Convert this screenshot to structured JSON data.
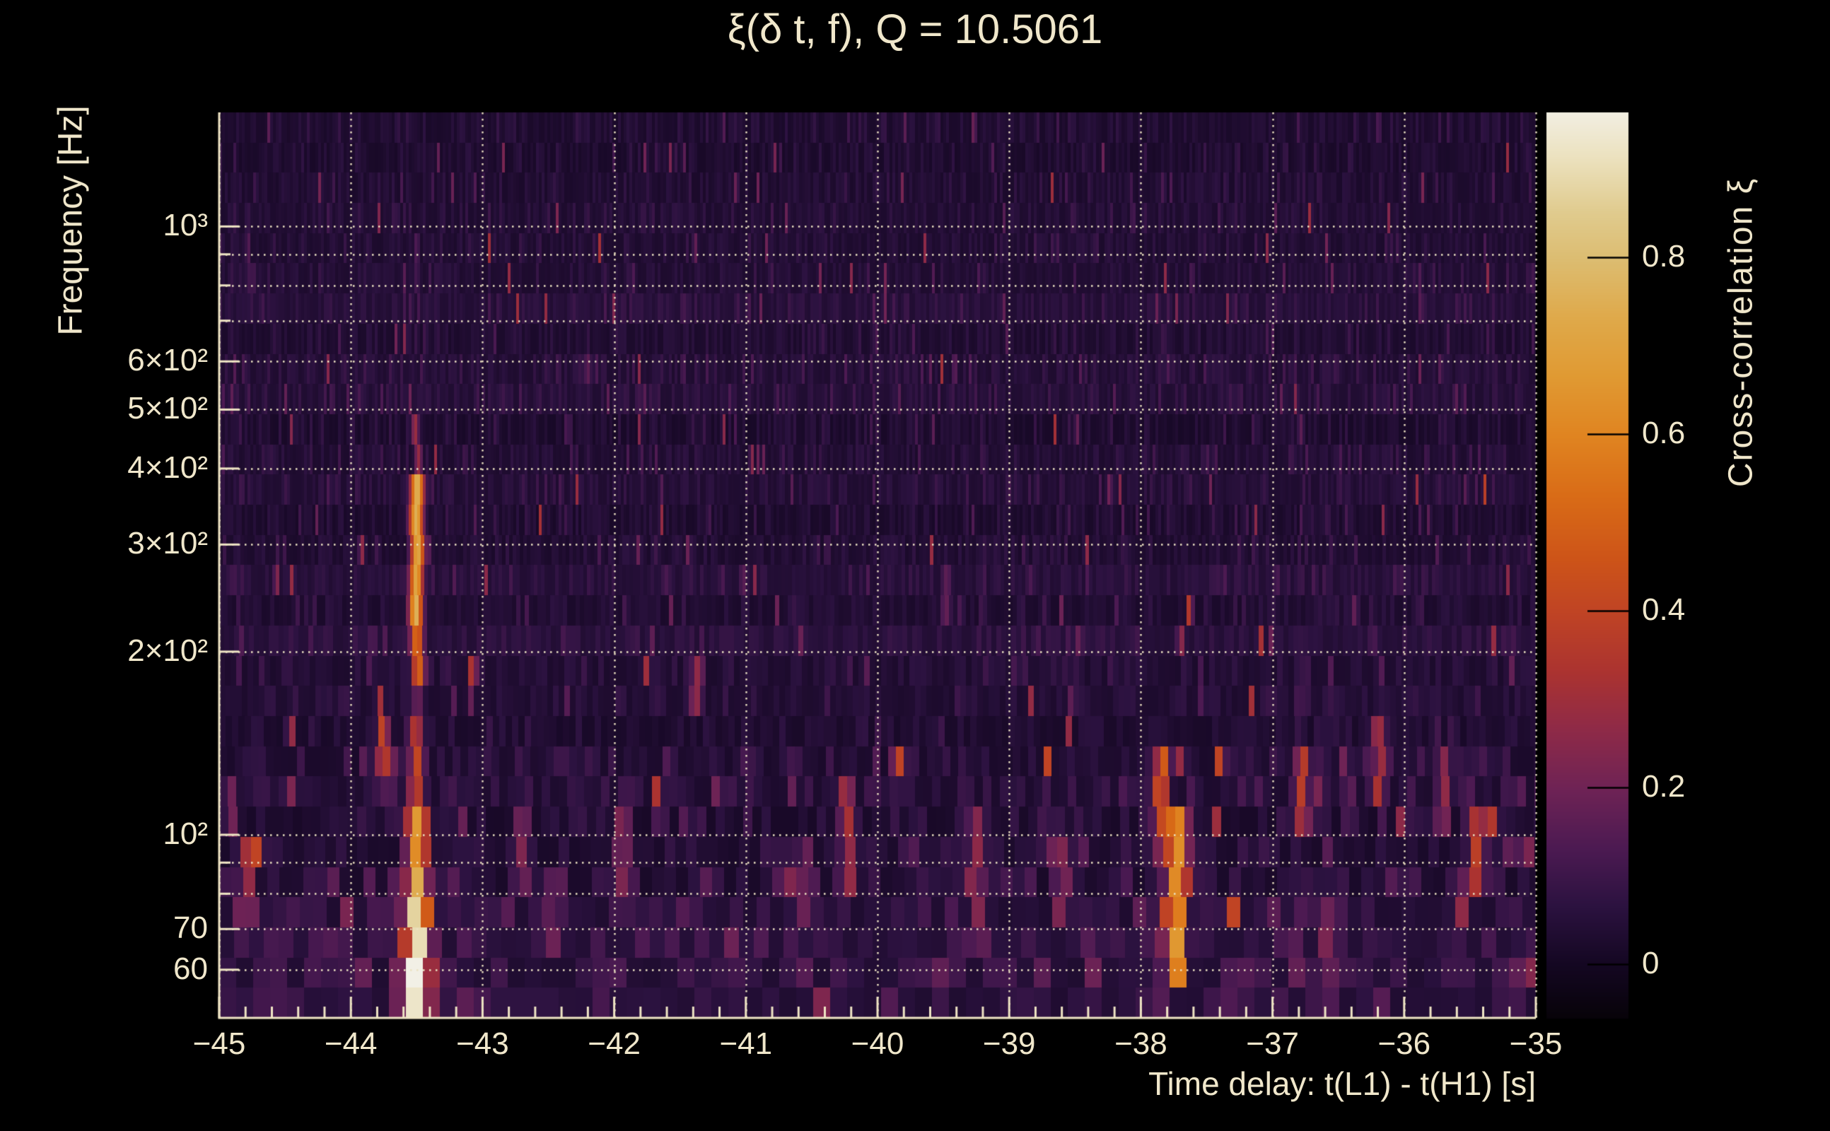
{
  "page": {
    "background": "#000000",
    "text_color": "#f0e7cb",
    "accent_grid_color": "#ece2c2"
  },
  "chart_data": {
    "type": "heatmap",
    "title": "ξ(δ t, f), Q = 10.5061",
    "q_value": "10.5061",
    "xlabel": "Time delay: t(L1) - t(H1) [s]",
    "ylabel": "Frequency [Hz]",
    "zlabel": "Cross-correlation ξ",
    "x_axis": {
      "min": -45,
      "max": -35,
      "minor_step": 0.2,
      "ticks": [
        {
          "t": -45,
          "label": "−45"
        },
        {
          "t": -44,
          "label": "−44"
        },
        {
          "t": -43,
          "label": "−43"
        },
        {
          "t": -42,
          "label": "−42"
        },
        {
          "t": -41,
          "label": "−41"
        },
        {
          "t": -40,
          "label": "−40"
        },
        {
          "t": -39,
          "label": "−39"
        },
        {
          "t": -38,
          "label": "−38"
        },
        {
          "t": -37,
          "label": "−37"
        },
        {
          "t": -36,
          "label": "−36"
        },
        {
          "t": -35,
          "label": "−35"
        }
      ]
    },
    "y_axis": {
      "scale": "log",
      "min_hz": 50,
      "max_hz": 1540,
      "gridline_freqs": [
        60,
        70,
        80,
        90,
        100,
        200,
        300,
        400,
        500,
        600,
        700,
        800,
        900,
        1000
      ],
      "ticks": [
        {
          "f": 1000,
          "label": "10³"
        },
        {
          "f": 600,
          "label": "6×10²"
        },
        {
          "f": 500,
          "label": "5×10²"
        },
        {
          "f": 400,
          "label": "4×10²"
        },
        {
          "f": 300,
          "label": "3×10²"
        },
        {
          "f": 200,
          "label": "2×10²"
        },
        {
          "f": 100,
          "label": "10²"
        },
        {
          "f": 70,
          "label": "70"
        },
        {
          "f": 60,
          "label": "60"
        }
      ]
    },
    "z_axis": {
      "min": -0.061,
      "max": 0.964,
      "ticks": [
        {
          "v": 0.8,
          "label": "0.8"
        },
        {
          "v": 0.6,
          "label": "0.6"
        },
        {
          "v": 0.4,
          "label": "0.4"
        },
        {
          "v": 0.2,
          "label": "0.2"
        },
        {
          "v": 0.0,
          "label": "0"
        }
      ]
    },
    "colormap": [
      [
        -0.061,
        "#070309"
      ],
      [
        0.0,
        "#140722"
      ],
      [
        0.067,
        "#2c1240"
      ],
      [
        0.131,
        "#4c1a52"
      ],
      [
        0.2,
        "#6f2355"
      ],
      [
        0.267,
        "#8f2a47"
      ],
      [
        0.331,
        "#ab3330"
      ],
      [
        0.4,
        "#c04424"
      ],
      [
        0.459,
        "#cd5418"
      ],
      [
        0.531,
        "#d96c17"
      ],
      [
        0.601,
        "#e08521"
      ],
      [
        0.667,
        "#e09a33"
      ],
      [
        0.731,
        "#dfa94a"
      ],
      [
        0.8,
        "#dcbd72"
      ],
      [
        0.851,
        "#e0cb8e"
      ],
      [
        0.915,
        "#ece2c0"
      ],
      [
        0.971,
        "#f2f0e6"
      ]
    ],
    "grid": {
      "style": "dotted",
      "color": "#ece2c2",
      "dash": [
        2.5,
        6.5
      ]
    },
    "noise": {
      "seed": 1337,
      "rows": 30,
      "band_boost_hz": [
        55,
        140
      ]
    },
    "features": [
      {
        "t": -43.5,
        "f_lo": 360,
        "f_hi": 490,
        "xi": 0.3,
        "sigma": 4
      },
      {
        "t": -43.5,
        "f_lo": 230,
        "f_hi": 360,
        "xi": 0.76,
        "sigma": 7
      },
      {
        "t": -43.5,
        "f_lo": 185,
        "f_hi": 230,
        "xi": 0.55,
        "sigma": 7
      },
      {
        "t": -43.5,
        "f_lo": 145,
        "f_hi": 185,
        "xi": 0.22,
        "sigma": 5
      },
      {
        "t": -43.5,
        "f_lo": 100,
        "f_hi": 145,
        "xi": 0.38,
        "sigma": 8
      },
      {
        "t": -43.5,
        "f_lo": 76,
        "f_hi": 100,
        "xi": 0.68,
        "sigma": 11
      },
      {
        "t": -43.5,
        "f_lo": 62,
        "f_hi": 76,
        "xi": 0.85,
        "sigma": 13
      },
      {
        "t": -43.5,
        "f_lo": 50,
        "f_hi": 62,
        "xi": 0.96,
        "sigma": 14
      },
      {
        "t": -44.79,
        "f_lo": 74,
        "f_hi": 96,
        "xi": 0.32,
        "sigma": 9
      },
      {
        "t": -44.9,
        "f_lo": 100,
        "f_hi": 122,
        "xi": 0.2,
        "sigma": 8
      },
      {
        "t": -44.6,
        "f_lo": 50,
        "f_hi": 60,
        "xi": 0.13,
        "sigma": 18
      },
      {
        "t": -43.75,
        "f_lo": 128,
        "f_hi": 150,
        "xi": 0.45,
        "sigma": 6
      },
      {
        "t": -42.7,
        "f_lo": 84,
        "f_hi": 100,
        "xi": 0.22,
        "sigma": 9
      },
      {
        "t": -42.45,
        "f_lo": 70,
        "f_hi": 88,
        "xi": 0.2,
        "sigma": 10
      },
      {
        "t": -42.1,
        "f_lo": 50,
        "f_hi": 58,
        "xi": 0.12,
        "sigma": 16
      },
      {
        "t": -41.93,
        "f_lo": 84,
        "f_hi": 106,
        "xi": 0.24,
        "sigma": 9
      },
      {
        "t": -41.37,
        "f_lo": 158,
        "f_hi": 186,
        "xi": 0.26,
        "sigma": 7
      },
      {
        "t": -40.55,
        "f_lo": 74,
        "f_hi": 95,
        "xi": 0.22,
        "sigma": 9
      },
      {
        "t": -40.23,
        "f_lo": 84,
        "f_hi": 112,
        "xi": 0.3,
        "sigma": 9
      },
      {
        "t": -39.47,
        "f_lo": 228,
        "f_hi": 262,
        "xi": 0.18,
        "sigma": 6
      },
      {
        "t": -39.25,
        "f_lo": 70,
        "f_hi": 108,
        "xi": 0.26,
        "sigma": 10
      },
      {
        "t": -38.6,
        "f_lo": 72,
        "f_hi": 95,
        "xi": 0.24,
        "sigma": 10
      },
      {
        "t": -37.84,
        "f_lo": 100,
        "f_hi": 130,
        "xi": 0.45,
        "sigma": 8
      },
      {
        "t": -37.73,
        "f_lo": 62,
        "f_hi": 100,
        "xi": 0.64,
        "sigma": 12
      },
      {
        "t": -37.3,
        "f_lo": 50,
        "f_hi": 62,
        "xi": 0.14,
        "sigma": 18
      },
      {
        "t": -36.77,
        "f_lo": 102,
        "f_hi": 130,
        "xi": 0.36,
        "sigma": 8
      },
      {
        "t": -36.6,
        "f_lo": 60,
        "f_hi": 76,
        "xi": 0.22,
        "sigma": 11
      },
      {
        "t": -36.19,
        "f_lo": 120,
        "f_hi": 148,
        "xi": 0.3,
        "sigma": 8
      },
      {
        "t": -35.7,
        "f_lo": 108,
        "f_hi": 128,
        "xi": 0.26,
        "sigma": 8
      },
      {
        "t": -35.45,
        "f_lo": 80,
        "f_hi": 100,
        "xi": 0.36,
        "sigma": 9
      },
      {
        "t": -35.2,
        "f_lo": 50,
        "f_hi": 62,
        "xi": 0.13,
        "sigma": 16
      }
    ],
    "legend_position": "right-colorbar"
  }
}
